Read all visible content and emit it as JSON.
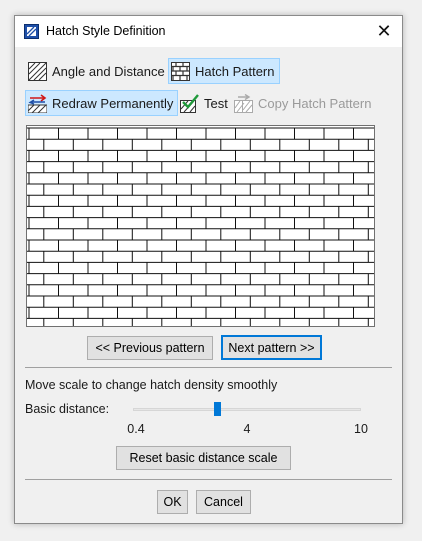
{
  "window": {
    "title": "Hatch Style Definition"
  },
  "toolbar": {
    "angle_distance_label": "Angle and Distance",
    "hatch_pattern_label": "Hatch Pattern",
    "redraw_label": "Redraw Permanently",
    "test_label": "Test",
    "copy_label": "Copy Hatch Pattern"
  },
  "nav": {
    "previous_label": "<< Previous pattern",
    "next_label": "Next pattern >>"
  },
  "density": {
    "hint": "Move scale to change hatch density smoothly",
    "basic_distance_label": "Basic distance:",
    "slider_value_fraction": 0.37,
    "ticks": [
      "0.4",
      "4",
      "10"
    ],
    "reset_label": "Reset basic distance scale"
  },
  "footer": {
    "ok_label": "OK",
    "cancel_label": "Cancel"
  },
  "colors": {
    "accent": "#0078d7",
    "active_bg": "#cce8ff"
  }
}
